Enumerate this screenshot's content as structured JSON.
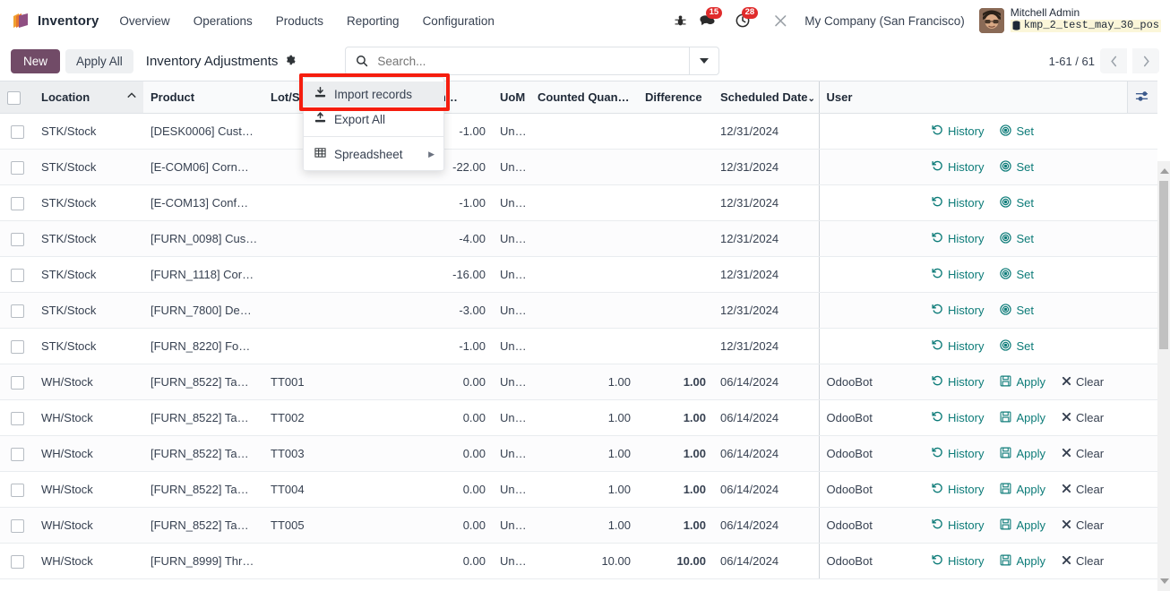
{
  "navbar": {
    "app_icon": "inventory-cube-icon",
    "app_name": "Inventory",
    "menus": [
      {
        "label": "Overview"
      },
      {
        "label": "Operations"
      },
      {
        "label": "Products"
      },
      {
        "label": "Reporting"
      },
      {
        "label": "Configuration"
      }
    ],
    "sys_icons": [
      {
        "name": "bug-icon",
        "glyph": "☣",
        "badge": null
      },
      {
        "name": "messages-icon",
        "glyph": "💬",
        "badge": "15"
      },
      {
        "name": "activities-clock-icon",
        "glyph": "◷",
        "badge": "28"
      },
      {
        "name": "tools-icon",
        "glyph": "⚒",
        "badge": null
      }
    ],
    "company": "My Company (San Francisco)",
    "user": {
      "name": "Mitchell Admin",
      "database": "kmp_2_test_may_30_pos",
      "db_icon": "database-icon"
    }
  },
  "control_panel": {
    "new_label": "New",
    "apply_all_label": "Apply All",
    "breadcrumb": "Inventory Adjustments",
    "gear_icon": "gear-icon",
    "search_placeholder": "Search...",
    "search_value": "",
    "search_icon": "search-icon",
    "search_caret_icon": "chevron-down-icon",
    "pager_text": "1-61 / 61",
    "prev_icon": "chevron-left-icon",
    "next_icon": "chevron-right-icon"
  },
  "dropdown": {
    "items": [
      {
        "label": "Import records",
        "icon": "import-download-icon",
        "active": true,
        "submenu": false
      },
      {
        "label": "Export All",
        "icon": "export-upload-icon",
        "active": false,
        "submenu": false
      },
      {
        "label": "Spreadsheet",
        "icon": "spreadsheet-grid-icon",
        "active": false,
        "submenu": true
      }
    ],
    "highlight_color": "#f51d0e"
  },
  "table": {
    "columns": [
      {
        "label": "",
        "key": "select"
      },
      {
        "label": "Location",
        "key": "location",
        "sorted": true,
        "sort_icon": "caret-up-icon"
      },
      {
        "label": "Product",
        "key": "product"
      },
      {
        "label": "Lot/Serial Number",
        "key": "lot",
        "display": "Lot/S…"
      },
      {
        "label": "On Hand Quantity",
        "key": "onhand",
        "display": "… Quan…"
      },
      {
        "label": "UoM",
        "key": "uom"
      },
      {
        "label": "Counted Quan…",
        "key": "counted"
      },
      {
        "label": "Difference",
        "key": "difference"
      },
      {
        "label": "Scheduled Date",
        "key": "scheduled",
        "sort_icon": "chevron-down-icon"
      },
      {
        "label": "User",
        "key": "user"
      },
      {
        "label": "",
        "key": "actions"
      },
      {
        "label": "",
        "key": "optional",
        "icon": "column-options-icon"
      }
    ],
    "action_labels": {
      "history": "History",
      "history_icon": "history-undo-icon",
      "set": "Set",
      "set_icon": "target-circle-icon",
      "apply": "Apply",
      "apply_icon": "save-floppy-icon",
      "clear": "Clear",
      "clear_icon": "close-x-icon"
    },
    "rows": [
      {
        "location": "STK/Stock",
        "product": "[DESK0006] Cust…",
        "lot": "",
        "onhand": "-1.00",
        "onhand_neg": true,
        "uom": "Un…",
        "counted": "",
        "difference": "",
        "scheduled": "12/31/2024",
        "user": "",
        "actions": [
          "history",
          "set"
        ]
      },
      {
        "location": "STK/Stock",
        "product": "[E-COM06] Corn…",
        "lot": "",
        "onhand": "-22.00",
        "onhand_neg": true,
        "uom": "Un…",
        "counted": "",
        "difference": "",
        "scheduled": "12/31/2024",
        "user": "",
        "actions": [
          "history",
          "set"
        ]
      },
      {
        "location": "STK/Stock",
        "product": "[E-COM13] Conf…",
        "lot": "",
        "onhand": "-1.00",
        "onhand_neg": true,
        "uom": "Un…",
        "counted": "",
        "difference": "",
        "scheduled": "12/31/2024",
        "user": "",
        "actions": [
          "history",
          "set"
        ]
      },
      {
        "location": "STK/Stock",
        "product": "[FURN_0098] Cus…",
        "lot": "",
        "onhand": "-4.00",
        "onhand_neg": true,
        "uom": "Un…",
        "counted": "",
        "difference": "",
        "scheduled": "12/31/2024",
        "user": "",
        "actions": [
          "history",
          "set"
        ]
      },
      {
        "location": "STK/Stock",
        "product": "[FURN_1118] Cor…",
        "lot": "",
        "onhand": "-16.00",
        "onhand_neg": true,
        "uom": "Un…",
        "counted": "",
        "difference": "",
        "scheduled": "12/31/2024",
        "user": "",
        "actions": [
          "history",
          "set"
        ]
      },
      {
        "location": "STK/Stock",
        "product": "[FURN_7800] De…",
        "lot": "",
        "onhand": "-3.00",
        "onhand_neg": true,
        "uom": "Un…",
        "counted": "",
        "difference": "",
        "scheduled": "12/31/2024",
        "user": "",
        "actions": [
          "history",
          "set"
        ]
      },
      {
        "location": "STK/Stock",
        "product": "[FURN_8220] Fo…",
        "lot": "",
        "onhand": "-1.00",
        "onhand_neg": true,
        "uom": "Un…",
        "counted": "",
        "difference": "",
        "scheduled": "12/31/2024",
        "user": "",
        "actions": [
          "history",
          "set"
        ]
      },
      {
        "location": "WH/Stock",
        "product": "[FURN_8522] Ta…",
        "lot": "TT001",
        "onhand": "0.00",
        "onhand_neg": false,
        "uom": "Un…",
        "counted": "1.00",
        "difference": "1.00",
        "scheduled": "06/14/2024",
        "user": "OdooBot",
        "actions": [
          "history",
          "apply",
          "clear"
        ]
      },
      {
        "location": "WH/Stock",
        "product": "[FURN_8522] Ta…",
        "lot": "TT002",
        "onhand": "0.00",
        "onhand_neg": false,
        "uom": "Un…",
        "counted": "1.00",
        "difference": "1.00",
        "scheduled": "06/14/2024",
        "user": "OdooBot",
        "actions": [
          "history",
          "apply",
          "clear"
        ]
      },
      {
        "location": "WH/Stock",
        "product": "[FURN_8522] Ta…",
        "lot": "TT003",
        "onhand": "0.00",
        "onhand_neg": false,
        "uom": "Un…",
        "counted": "1.00",
        "difference": "1.00",
        "scheduled": "06/14/2024",
        "user": "OdooBot",
        "actions": [
          "history",
          "apply",
          "clear"
        ]
      },
      {
        "location": "WH/Stock",
        "product": "[FURN_8522] Ta…",
        "lot": "TT004",
        "onhand": "0.00",
        "onhand_neg": false,
        "uom": "Un…",
        "counted": "1.00",
        "difference": "1.00",
        "scheduled": "06/14/2024",
        "user": "OdooBot",
        "actions": [
          "history",
          "apply",
          "clear"
        ]
      },
      {
        "location": "WH/Stock",
        "product": "[FURN_8522] Ta…",
        "lot": "TT005",
        "onhand": "0.00",
        "onhand_neg": false,
        "uom": "Un…",
        "counted": "1.00",
        "difference": "1.00",
        "scheduled": "06/14/2024",
        "user": "OdooBot",
        "actions": [
          "history",
          "apply",
          "clear"
        ]
      },
      {
        "location": "WH/Stock",
        "product": "[FURN_8999] Thr…",
        "lot": "",
        "onhand": "0.00",
        "onhand_neg": false,
        "uom": "Un…",
        "counted": "10.00",
        "difference": "10.00",
        "scheduled": "06/14/2024",
        "user": "OdooBot",
        "actions": [
          "history",
          "apply",
          "clear"
        ]
      }
    ]
  },
  "colors": {
    "primary": "#714b67",
    "accent_teal": "#0c7b78",
    "negative": "#b68512",
    "positive": "#1ea01e",
    "badge_red": "#e02b2b"
  }
}
